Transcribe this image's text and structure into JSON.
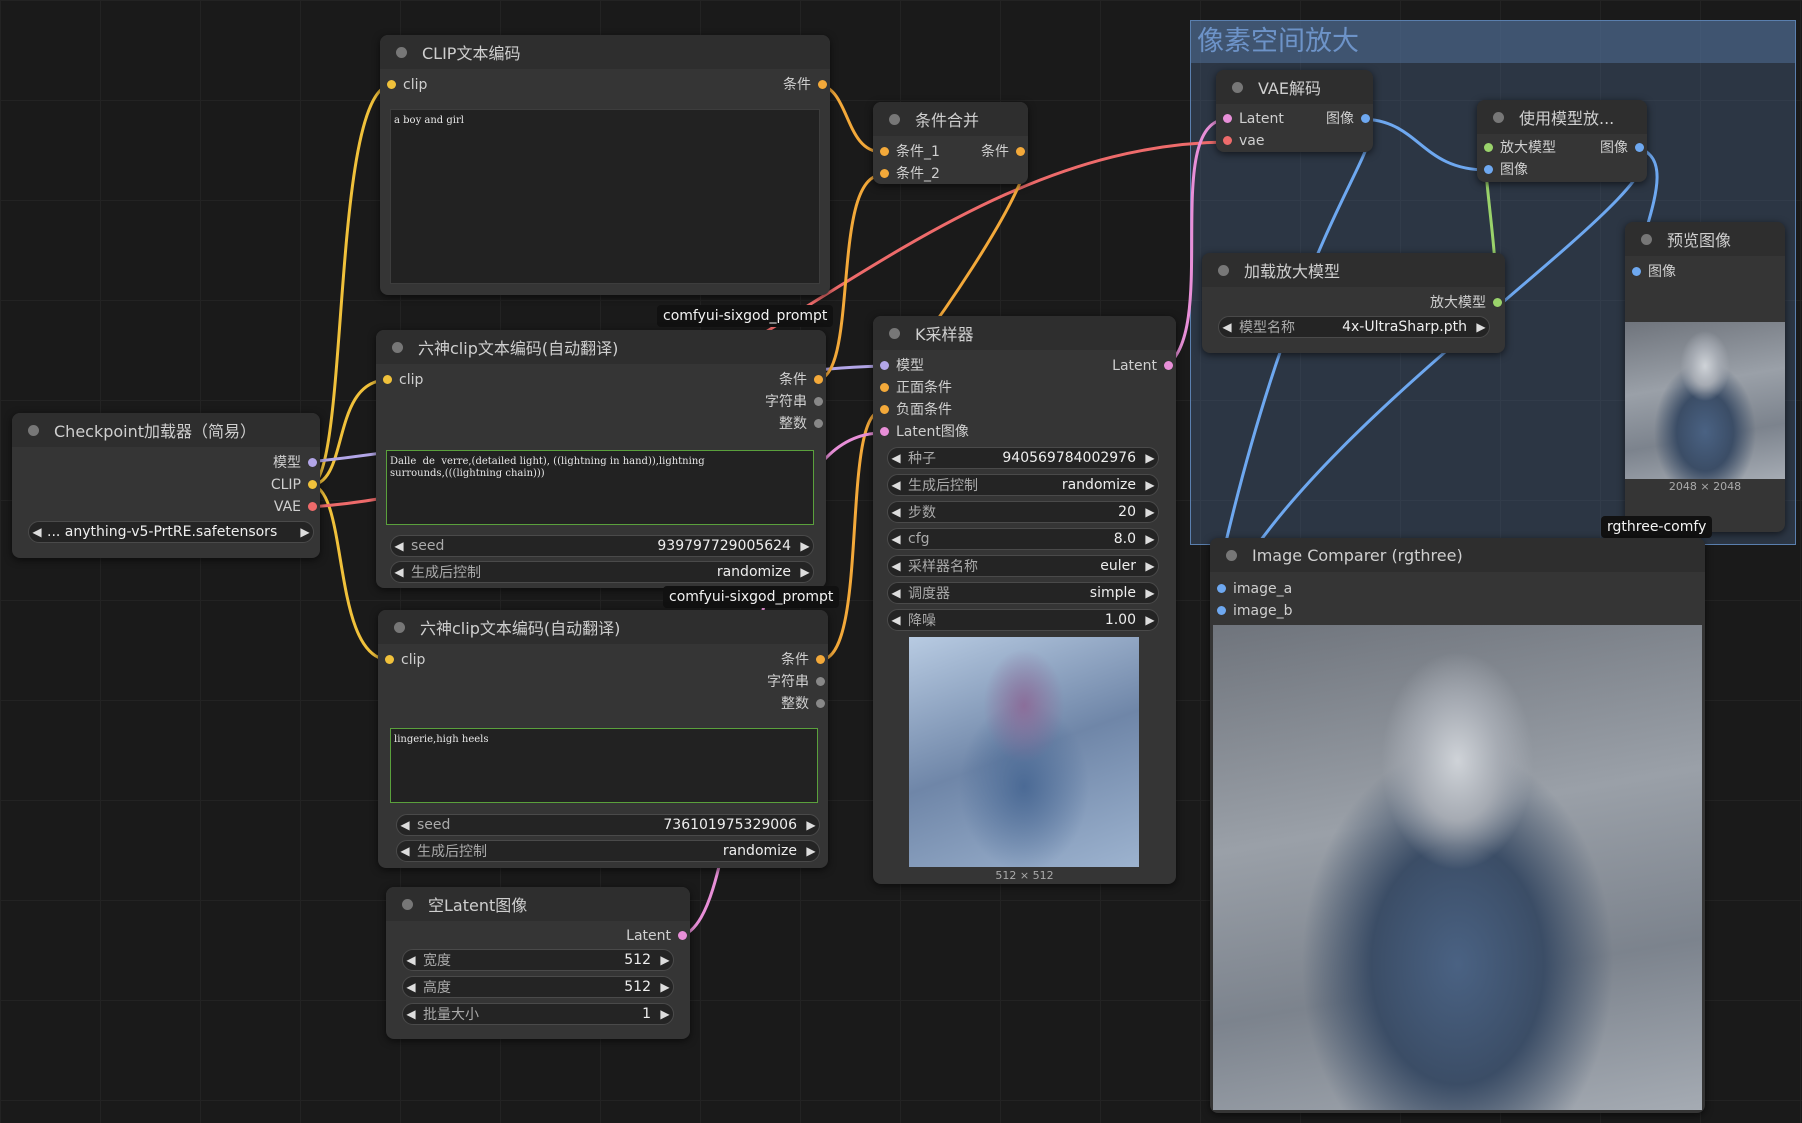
{
  "colors": {
    "clip": "#f0c13b",
    "model": "#b3a6e8",
    "vae": "#ee6b6b",
    "cond": "#f3a93a",
    "latent": "#e88fd8",
    "image": "#6ea8f0",
    "upscale": "#9ad36b",
    "string": "#888888"
  },
  "group": {
    "title": "像素空间放大"
  },
  "nodes": {
    "clip_encode": {
      "title": "CLIP文本编码",
      "in_clip": "clip",
      "out_cond": "条件",
      "text": "a boy and girl",
      "badge": "comfyui-sixgod_prompt"
    },
    "sixgod1": {
      "title": "六神clip文本编码(自动翻译)",
      "in_clip": "clip",
      "out_cond": "条件",
      "out_str": "字符串",
      "out_int": "整数",
      "text": "Dalle  de  verre,(detailed light), ((lightning in hand)),lightning\nsurrounds,(((lightning chain)))",
      "seed_label": "seed",
      "seed_value": "939797729005624",
      "ctrl_label": "生成后控制",
      "ctrl_value": "randomize",
      "badge": "comfyui-sixgod_prompt"
    },
    "sixgod2": {
      "title": "六神clip文本编码(自动翻译)",
      "in_clip": "clip",
      "out_cond": "条件",
      "out_str": "字符串",
      "out_int": "整数",
      "text": "lingerie,high heels",
      "seed_label": "seed",
      "seed_value": "736101975329006",
      "ctrl_label": "生成后控制",
      "ctrl_value": "randomize"
    },
    "checkpoint": {
      "title": "Checkpoint加载器（简易）",
      "out_model": "模型",
      "out_clip": "CLIP",
      "out_vae": "VAE",
      "ckpt_value": "... anything-v5-PrtRE.safetensors"
    },
    "cond_merge": {
      "title": "条件合并",
      "in1": "条件_1",
      "in2": "条件_2",
      "out": "条件"
    },
    "ksampler": {
      "title": "K采样器",
      "in_model": "模型",
      "in_pos": "正面条件",
      "in_neg": "负面条件",
      "in_latent": "Latent图像",
      "out_latent": "Latent",
      "widgets": [
        {
          "label": "种子",
          "value": "940569784002976"
        },
        {
          "label": "生成后控制",
          "value": "randomize"
        },
        {
          "label": "步数",
          "value": "20"
        },
        {
          "label": "cfg",
          "value": "8.0"
        },
        {
          "label": "采样器名称",
          "value": "euler"
        },
        {
          "label": "调度器",
          "value": "simple"
        },
        {
          "label": "降噪",
          "value": "1.00"
        }
      ],
      "image_caption": "512 × 512"
    },
    "empty_latent": {
      "title": "空Latent图像",
      "out_latent": "Latent",
      "widgets": [
        {
          "label": "宽度",
          "value": "512"
        },
        {
          "label": "高度",
          "value": "512"
        },
        {
          "label": "批量大小",
          "value": "1"
        }
      ]
    },
    "vae_decode": {
      "title": "VAE解码",
      "in_latent": "Latent",
      "in_vae": "vae",
      "out_image": "图像"
    },
    "upscale_with_model": {
      "title": "使用模型放...",
      "in_model": "放大模型",
      "in_image": "图像",
      "out_image": "图像"
    },
    "load_upscale": {
      "title": "加载放大模型",
      "out_model": "放大模型",
      "model_label": "模型名称",
      "model_value": "4x-UltraSharp.pth"
    },
    "preview": {
      "title": "预览图像",
      "in_image": "图像",
      "image_caption": "2048 × 2048",
      "badge": "rgthree-comfy"
    },
    "comparer": {
      "title": "Image Comparer (rgthree)",
      "in_a": "image_a",
      "in_b": "image_b"
    }
  }
}
